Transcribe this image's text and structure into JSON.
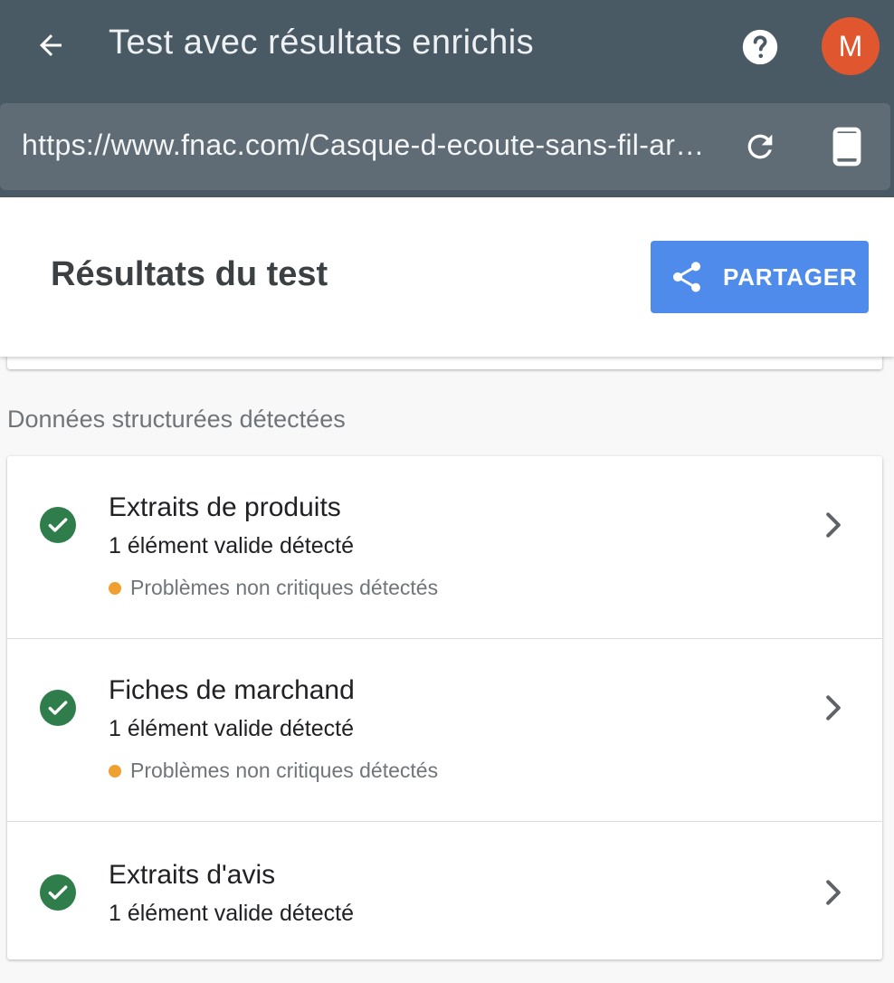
{
  "app": {
    "title": "Test avec résultats enrichis",
    "avatar_letter": "M",
    "avatar_color": "#e0572f",
    "appbar_color": "#4a5a64"
  },
  "url_bar": {
    "url": "https://www.fnac.com/Casque-d-ecoute-sans-fil-arc..."
  },
  "icons": {
    "back": "arrow-back-icon",
    "help": "help-icon",
    "reload": "reload-icon",
    "device": "smartphone-icon",
    "share": "share-icon",
    "valid": "check-circle-icon",
    "open": "chevron-right-icon"
  },
  "results": {
    "title": "Résultats du test",
    "share_label": "PARTAGER",
    "share_color": "#4f8bea"
  },
  "structured_data": {
    "section_label": "Données structurées détectées",
    "items": [
      {
        "title": "Extraits de produits",
        "subtitle": "1 élément valide détecté",
        "warning": "Problèmes non critiques détectés",
        "status_color": "#2e7d4b"
      },
      {
        "title": "Fiches de marchand",
        "subtitle": "1 élément valide détecté",
        "warning": "Problèmes non critiques détectés",
        "status_color": "#2e7d4b"
      },
      {
        "title": "Extraits d'avis",
        "subtitle": "1 élément valide détecté",
        "status_color": "#2e7d4b"
      }
    ],
    "warning_color": "#f0a030"
  }
}
